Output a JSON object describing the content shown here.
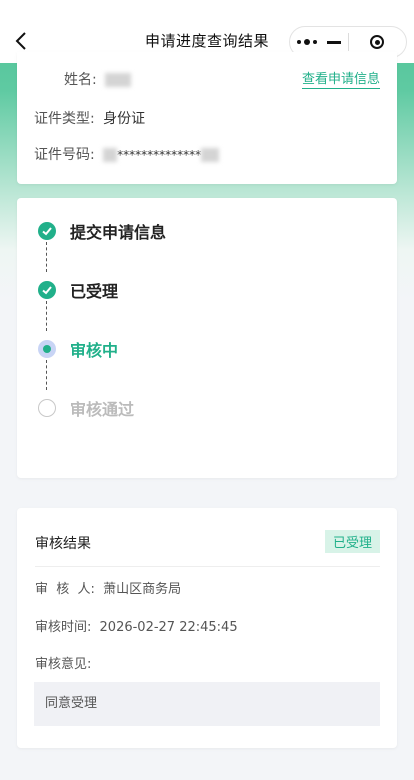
{
  "navbar": {
    "title": "申请进度查询结果",
    "back_icon": "chevron-left-icon",
    "more_icon": "more-dots-icon",
    "minimize_icon": "minus-icon",
    "close_icon": "target-icon"
  },
  "applicant": {
    "name_label": "姓名:",
    "id_type_label": "证件类型:",
    "id_type_value": "身份证",
    "id_number_label": "证件号码:",
    "id_number_masked": "**************",
    "view_link": "查看申请信息"
  },
  "steps": [
    {
      "label": "提交申请信息",
      "status": "done"
    },
    {
      "label": "已受理",
      "status": "done"
    },
    {
      "label": "审核中",
      "status": "current"
    },
    {
      "label": "审核通过",
      "status": "pending"
    }
  ],
  "result": {
    "title": "审核结果",
    "badge": "已受理",
    "reviewer_label": "审  核  人:",
    "reviewer_value": "萧山区商务局",
    "time_label": "审核时间:",
    "time_value": "2026-02-27 22:45:45",
    "opinion_label": "审核意见:",
    "opinion_value": "同意受理"
  },
  "colors": {
    "accent": "#21b08a",
    "header_gradient": "#4cc295",
    "current_ring": "#c8d4f5",
    "pending": "#c8c8c8"
  }
}
